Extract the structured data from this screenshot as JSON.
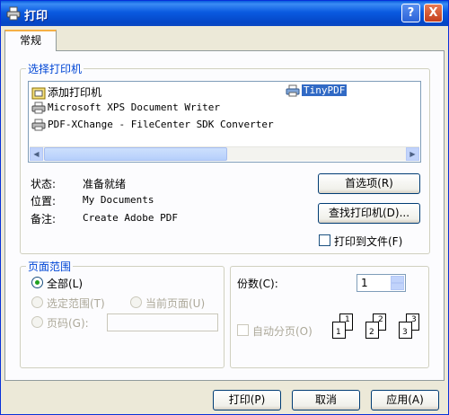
{
  "window": {
    "title": "打印",
    "help_label": "?",
    "close_label": "X"
  },
  "tabs": [
    {
      "label": "常规"
    }
  ],
  "printer_group": {
    "legend": "选择打印机",
    "printers": [
      {
        "name": "添加打印机",
        "icon": "add-printer-icon"
      },
      {
        "name": "TinyPDF",
        "icon": "printer-icon",
        "selected": true
      },
      {
        "name": "Microsoft XPS Document Writer",
        "icon": "printer-icon"
      },
      {
        "name": "PDF-XChange - FileCenter SDK Converter",
        "icon": "printer-icon"
      }
    ],
    "scroll_left": "◀",
    "scroll_right": "▶",
    "status": {
      "label": "状态:",
      "value": "准备就绪"
    },
    "location": {
      "label": "位置:",
      "value": "My Documents"
    },
    "comment": {
      "label": "备注:",
      "value": "Create Adobe PDF"
    },
    "preferences_button": "首选项(R)",
    "find_printer_button": "查找打印机(D)...",
    "print_to_file_label": "打印到文件(F)",
    "print_to_file_checked": false
  },
  "page_range": {
    "legend": "页面范围",
    "all_label": "全部(L)",
    "selection_label": "选定范围(T)",
    "current_page_label": "当前页面(U)",
    "pages_label": "页码(G):",
    "pages_value": "",
    "selected_option": "all"
  },
  "copies": {
    "label": "份数(C):",
    "value": "1",
    "collate_label": "自动分页(O)",
    "collate_checked": false,
    "collate_pages": [
      "1",
      "1",
      "2",
      "2",
      "3",
      "3"
    ]
  },
  "footer": {
    "print_button": "打印(P)",
    "cancel_button": "取消",
    "apply_button": "应用(A)"
  },
  "colors": {
    "title_bar": "#0a5ae0",
    "selection": "#316ac5",
    "accent_tab": "#f5b045"
  }
}
